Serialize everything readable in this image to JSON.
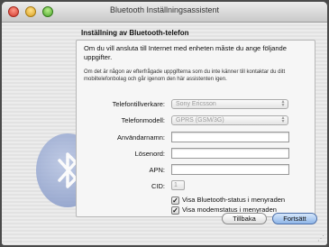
{
  "window": {
    "title": "Bluetooth Inställningsassistent"
  },
  "section": {
    "heading": "Inställning av Bluetooth-telefon",
    "intro": "Om du vill ansluta till Internet med enheten måste du ange följande uppgifter.",
    "note": "Om det är någon av efterfrågade uppgifterna som du inte känner till kontaktar du ditt mobiltelefonbolag och går igenom den här assistenten igen."
  },
  "form": {
    "manufacturer": {
      "label": "Telefontillverkare:",
      "value": "Sony Ericsson"
    },
    "model": {
      "label": "Telefonmodell:",
      "value": "GPRS (GSM/3G)"
    },
    "username": {
      "label": "Användarnamn:",
      "value": ""
    },
    "password": {
      "label": "Lösenord:",
      "value": ""
    },
    "apn": {
      "label": "APN:",
      "value": ""
    },
    "cid": {
      "label": "CID:",
      "value": "1"
    }
  },
  "options": {
    "bt_status": {
      "label": "Visa Bluetooth-status i menyraden",
      "checked": true
    },
    "modem_status": {
      "label": "Visa modemstatus i menyraden",
      "checked": true
    }
  },
  "buttons": {
    "back": "Tillbaka",
    "continue": "Fortsätt"
  },
  "icons": {
    "bluetooth": "bluetooth-icon",
    "check": "✓"
  }
}
